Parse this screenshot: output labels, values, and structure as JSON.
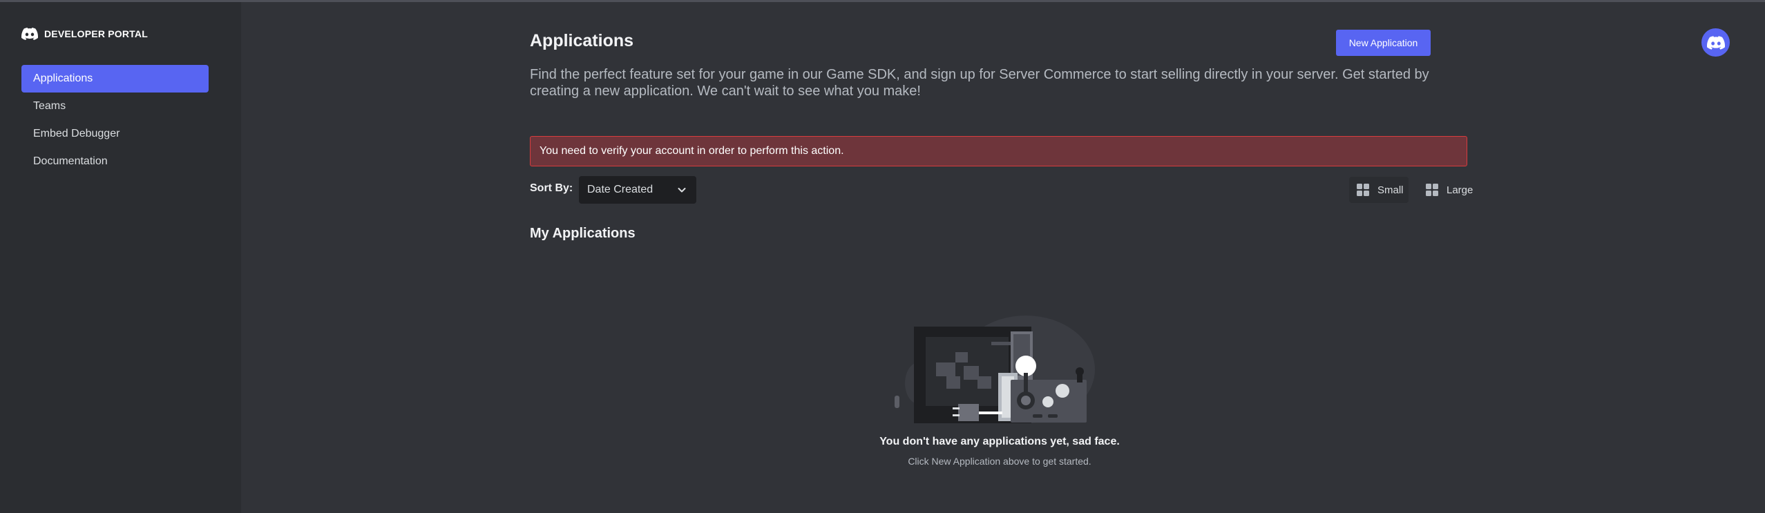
{
  "brand": {
    "label": "DEVELOPER PORTAL",
    "icon": "discord-logo-icon"
  },
  "sidebar": {
    "items": [
      {
        "label": "Applications",
        "active": true
      },
      {
        "label": "Teams",
        "active": false
      },
      {
        "label": "Embed Debugger",
        "active": false
      },
      {
        "label": "Documentation",
        "active": false
      }
    ]
  },
  "header": {
    "title": "Applications",
    "new_app_label": "New Application",
    "description": "Find the perfect feature set for your game in our Game SDK, and sign up for Server Commerce to start selling directly in your server. Get started by creating a new application. We can't wait to see what you make!"
  },
  "alert": {
    "text": "You need to verify your account in order to perform this action.",
    "color": "#6e353b"
  },
  "sort": {
    "label": "Sort By:",
    "value": "Date Created"
  },
  "view_toggle": {
    "small_label": "Small",
    "large_label": "Large",
    "selected": "Small"
  },
  "section": {
    "title": "My Applications"
  },
  "empty_state": {
    "title": "You don't have any applications yet, sad face.",
    "subtitle": "Click New Application above to get started.",
    "illustration": "arcade-cabinet-illustration"
  },
  "colors": {
    "accent": "#5865f2",
    "background": "#313338",
    "sidebar": "#2b2d31"
  }
}
